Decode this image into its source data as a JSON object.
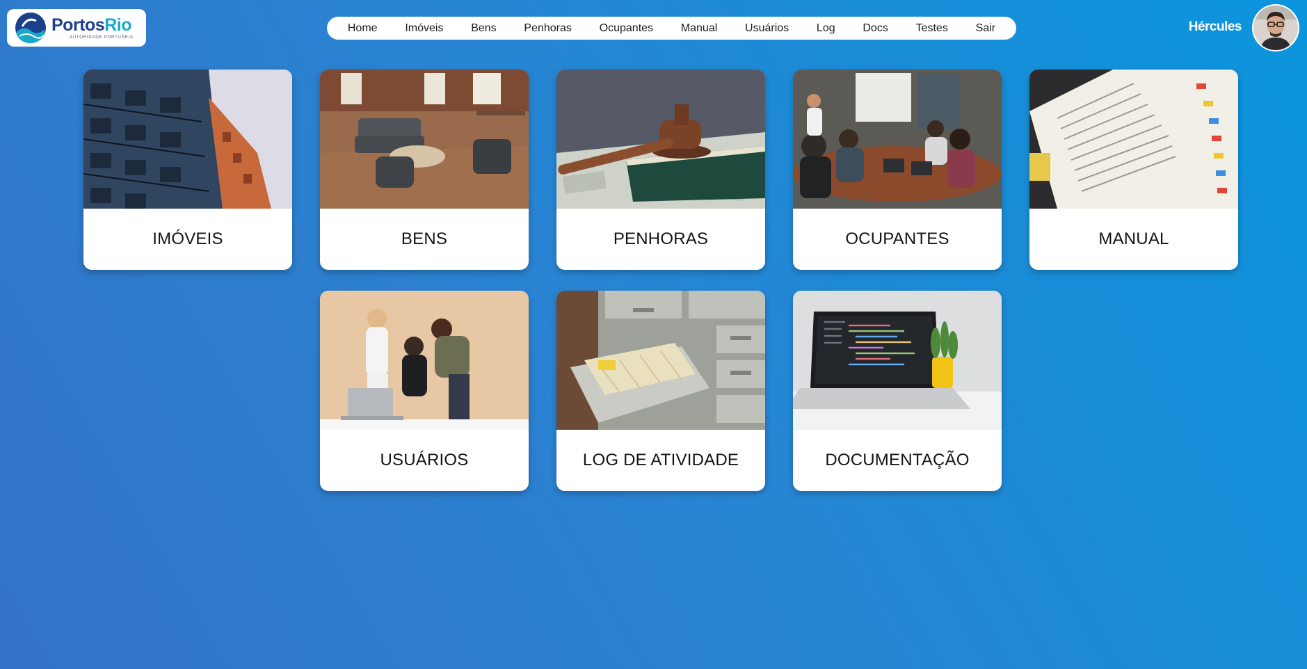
{
  "header": {
    "logo": {
      "name_part1": "Portos",
      "name_part2": "Rio",
      "subtitle": "AUTORIDADE PORTUÁRIA"
    },
    "nav": [
      "Home",
      "Imóveis",
      "Bens",
      "Penhoras",
      "Ocupantes",
      "Manual",
      "Usuários",
      "Log",
      "Docs",
      "Testes",
      "Sair"
    ],
    "user_name": "Hércules"
  },
  "cards": [
    {
      "label": "IMÓVEIS",
      "image": "apartment-building-photo"
    },
    {
      "label": "BENS",
      "image": "office-lounge-furniture-photo"
    },
    {
      "label": "PENHORAS",
      "image": "judge-gavel-on-money-photo"
    },
    {
      "label": "OCUPANTES",
      "image": "meeting-room-people-photo"
    },
    {
      "label": "MANUAL",
      "image": "open-book-with-tabs-photo"
    },
    {
      "label": "USUÁRIOS",
      "image": "team-at-laptop-photo"
    },
    {
      "label": "LOG DE ATIVIDADE",
      "image": "file-cabinet-drawer-photo"
    },
    {
      "label": "DOCUMENTAÇÃO",
      "image": "laptop-with-code-photo"
    }
  ],
  "colors": {
    "background_start": "#3372c6",
    "background_end": "#0b95dd",
    "logo_dark": "#1c3f8c",
    "logo_light": "#17a9c9"
  }
}
